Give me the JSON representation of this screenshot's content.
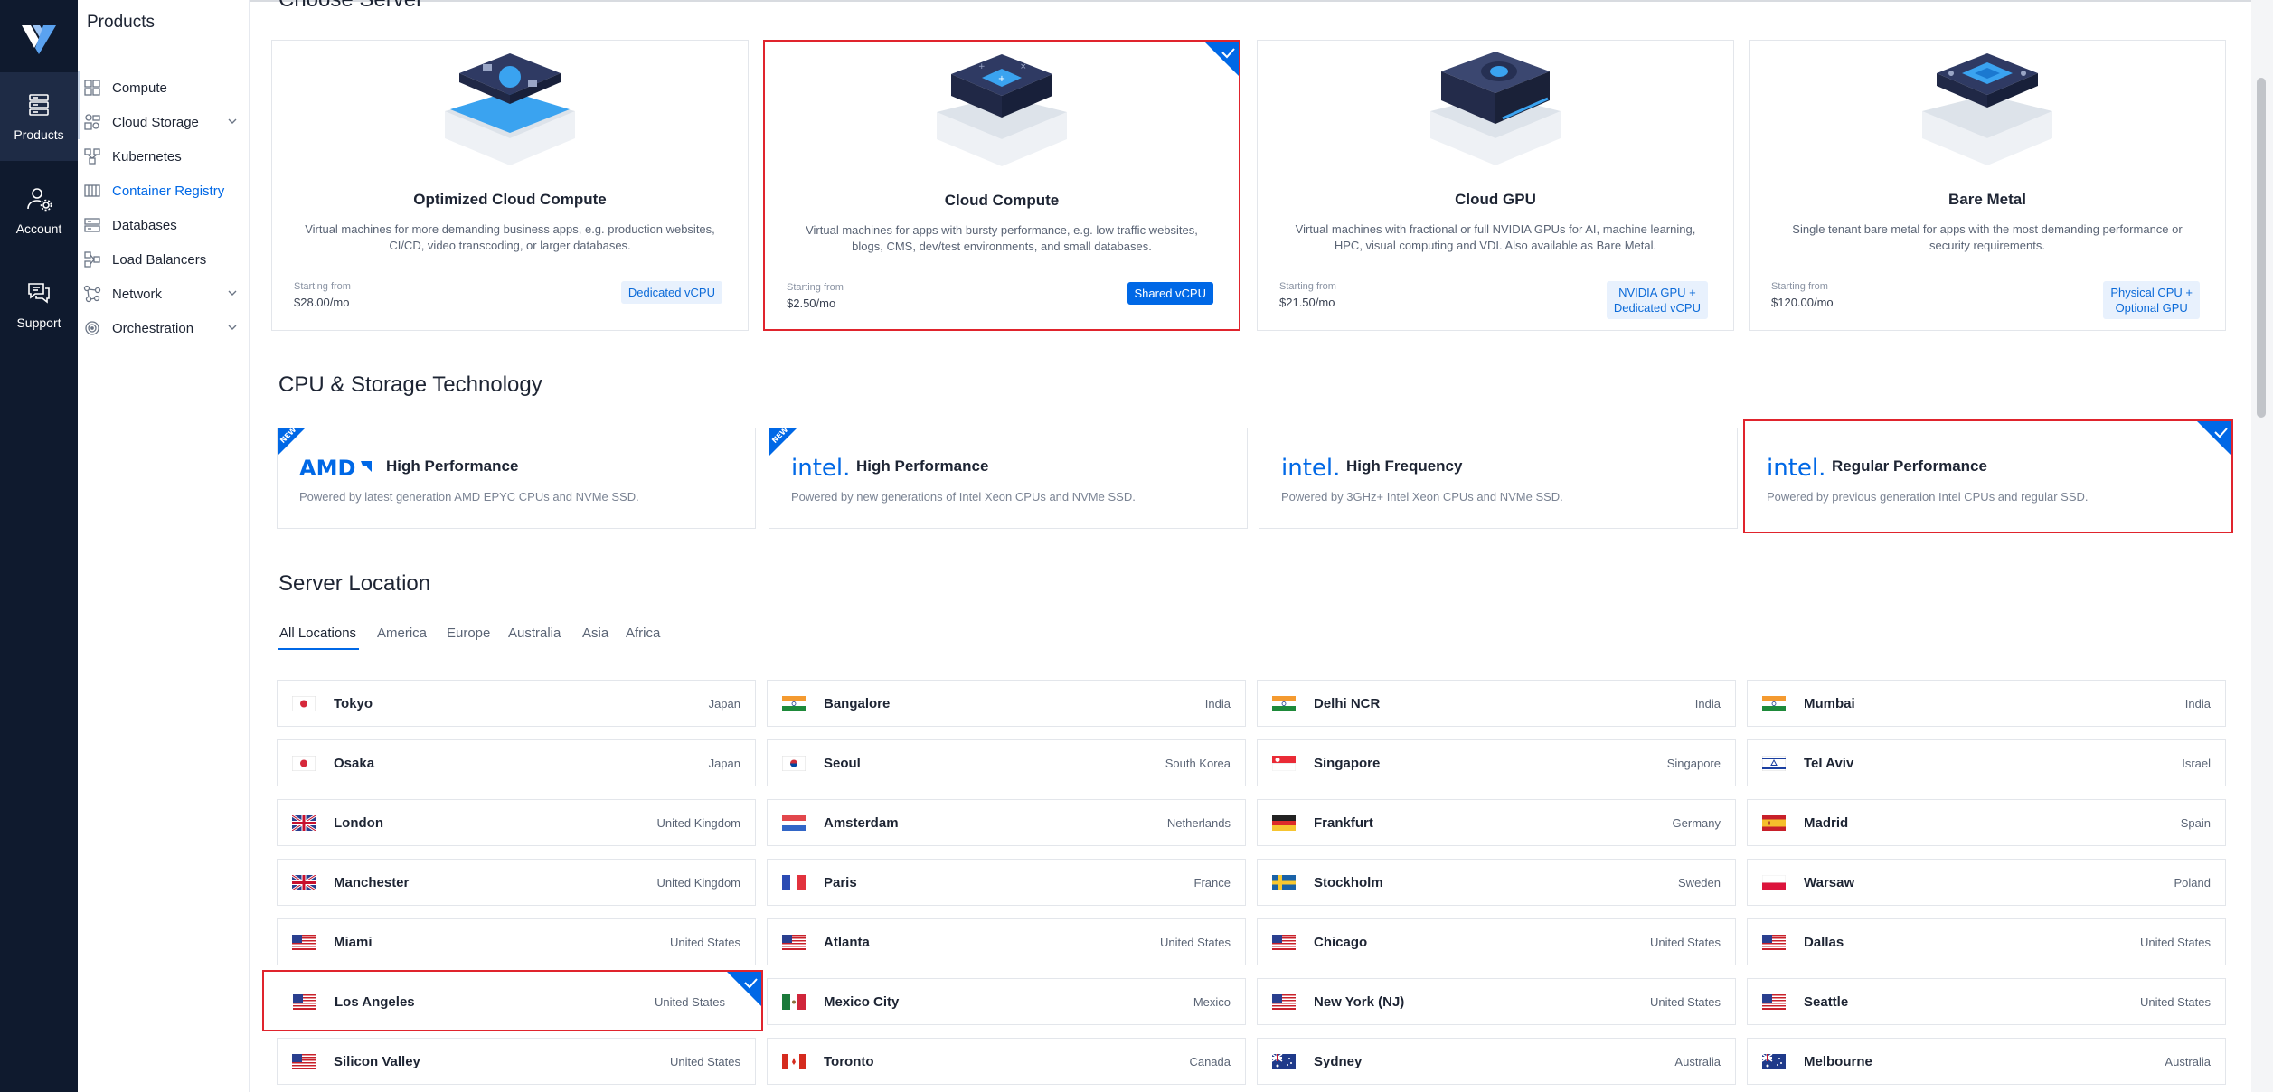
{
  "rail": {
    "items": [
      {
        "label": "Products",
        "icon": "server-stack-icon"
      },
      {
        "label": "Account",
        "icon": "user-gear-icon"
      },
      {
        "label": "Support",
        "icon": "chat-bubbles-icon"
      }
    ]
  },
  "nav": {
    "title": "Products",
    "items": [
      {
        "label": "Compute",
        "icon": "compute-icon"
      },
      {
        "label": "Cloud Storage",
        "icon": "cloud-storage-icon"
      },
      {
        "label": "Kubernetes",
        "icon": "kubernetes-icon"
      },
      {
        "label": "Container Registry",
        "icon": "container-registry-icon"
      },
      {
        "label": "Databases",
        "icon": "databases-icon"
      },
      {
        "label": "Load Balancers",
        "icon": "load-balancers-icon"
      },
      {
        "label": "Network",
        "icon": "network-icon"
      },
      {
        "label": "Orchestration",
        "icon": "orchestration-icon"
      }
    ]
  },
  "server": {
    "section_title": "Choose Server",
    "cards": [
      {
        "name": "Optimized Cloud Compute",
        "desc": "Virtual machines for more demanding business apps, e.g. production websites, CI/CD, video transcoding, or larger databases.",
        "start_label": "Starting from",
        "price": "$28.00/mo",
        "badge": "Dedicated vCPU"
      },
      {
        "name": "Cloud Compute",
        "desc": "Virtual machines for apps with bursty performance, e.g. low traffic websites, blogs, CMS, dev/test environments, and small databases.",
        "start_label": "Starting from",
        "price": "$2.50/mo",
        "badge": "Shared vCPU"
      },
      {
        "name": "Cloud GPU",
        "desc": "Virtual machines with fractional or full NVIDIA GPUs for AI, machine learning, HPC, visual computing and VDI. Also available as Bare Metal.",
        "start_label": "Starting from",
        "price": "$21.50/mo",
        "badge_line1": "NVIDIA GPU +",
        "badge_line2": "Dedicated vCPU"
      },
      {
        "name": "Bare Metal",
        "desc": "Single tenant bare metal for apps with the most demanding performance or security requirements.",
        "start_label": "Starting from",
        "price": "$120.00/mo",
        "badge_line1": "Physical CPU +",
        "badge_line2": "Optional GPU"
      }
    ]
  },
  "cpu": {
    "section_title": "CPU & Storage Technology",
    "cards": [
      {
        "brand": "AMD",
        "title": "High Performance",
        "desc": "Powered by latest generation AMD EPYC CPUs and NVMe SSD.",
        "tag": "NEW"
      },
      {
        "brand": "intel.",
        "title": "High Performance",
        "desc": "Powered by new generations of Intel Xeon CPUs and NVMe SSD.",
        "tag": "NEW"
      },
      {
        "brand": "intel.",
        "title": "High Frequency",
        "desc": "Powered by 3GHz+ Intel Xeon CPUs and NVMe SSD."
      },
      {
        "brand": "intel.",
        "title": "Regular Performance",
        "desc": "Powered by previous generation Intel CPUs and regular SSD."
      }
    ]
  },
  "location": {
    "section_title": "Server Location",
    "tabs": [
      "All Locations",
      "America",
      "Europe",
      "Australia",
      "Asia",
      "Africa"
    ],
    "items": [
      {
        "city": "Tokyo",
        "country": "Japan",
        "flag": "jp"
      },
      {
        "city": "Bangalore",
        "country": "India",
        "flag": "in"
      },
      {
        "city": "Delhi NCR",
        "country": "India",
        "flag": "in"
      },
      {
        "city": "Mumbai",
        "country": "India",
        "flag": "in"
      },
      {
        "city": "Osaka",
        "country": "Japan",
        "flag": "jp"
      },
      {
        "city": "Seoul",
        "country": "South Korea",
        "flag": "kr"
      },
      {
        "city": "Singapore",
        "country": "Singapore",
        "flag": "sg"
      },
      {
        "city": "Tel Aviv",
        "country": "Israel",
        "flag": "il"
      },
      {
        "city": "London",
        "country": "United Kingdom",
        "flag": "gb"
      },
      {
        "city": "Amsterdam",
        "country": "Netherlands",
        "flag": "nl"
      },
      {
        "city": "Frankfurt",
        "country": "Germany",
        "flag": "de"
      },
      {
        "city": "Madrid",
        "country": "Spain",
        "flag": "es"
      },
      {
        "city": "Manchester",
        "country": "United Kingdom",
        "flag": "gb"
      },
      {
        "city": "Paris",
        "country": "France",
        "flag": "fr"
      },
      {
        "city": "Stockholm",
        "country": "Sweden",
        "flag": "se"
      },
      {
        "city": "Warsaw",
        "country": "Poland",
        "flag": "pl"
      },
      {
        "city": "Miami",
        "country": "United States",
        "flag": "us"
      },
      {
        "city": "Atlanta",
        "country": "United States",
        "flag": "us"
      },
      {
        "city": "Chicago",
        "country": "United States",
        "flag": "us"
      },
      {
        "city": "Dallas",
        "country": "United States",
        "flag": "us"
      },
      {
        "city": "Los Angeles",
        "country": "United States",
        "flag": "us"
      },
      {
        "city": "Mexico City",
        "country": "Mexico",
        "flag": "mx"
      },
      {
        "city": "New York (NJ)",
        "country": "United States",
        "flag": "us"
      },
      {
        "city": "Seattle",
        "country": "United States",
        "flag": "us"
      },
      {
        "city": "Silicon Valley",
        "country": "United States",
        "flag": "us"
      },
      {
        "city": "Toronto",
        "country": "Canada",
        "flag": "ca"
      },
      {
        "city": "Sydney",
        "country": "Australia",
        "flag": "au"
      },
      {
        "city": "Melbourne",
        "country": "Australia",
        "flag": "au"
      }
    ]
  },
  "colors": {
    "accent": "#0068e6",
    "selection": "#e0242d",
    "rail": "#0f1a2e"
  }
}
